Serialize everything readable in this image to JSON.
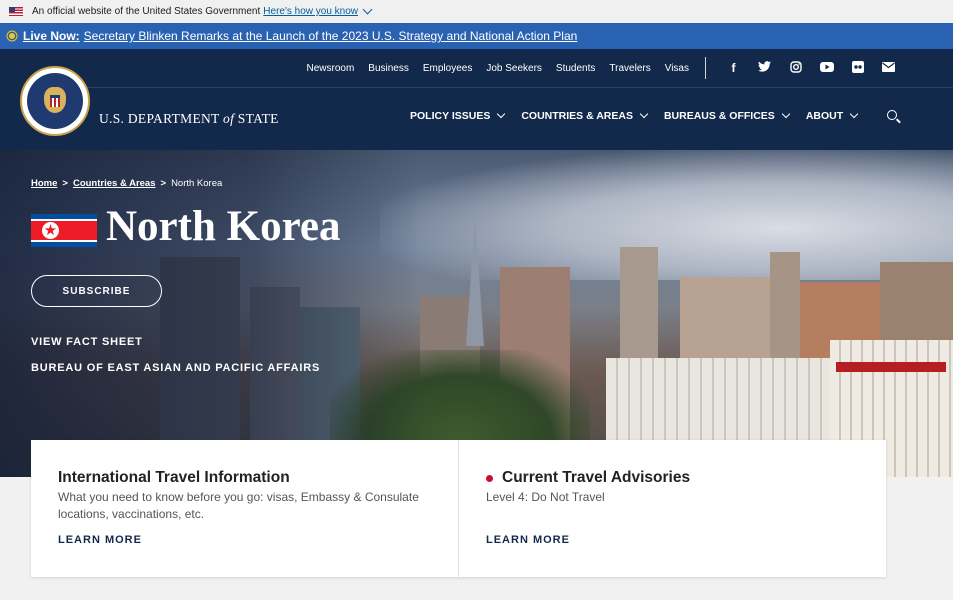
{
  "gov_banner": {
    "text": "An official website of the United States Government",
    "link": "Here's how you know"
  },
  "alert": {
    "label": "Live Now:",
    "message": "Secretary Blinken Remarks at the Launch of the 2023 U.S. Strategy and National Action Plan"
  },
  "utility_nav": [
    "Newsroom",
    "Business",
    "Employees",
    "Job Seekers",
    "Students",
    "Travelers",
    "Visas"
  ],
  "social_icons": [
    "facebook-icon",
    "twitter-icon",
    "instagram-icon",
    "youtube-icon",
    "flickr-icon",
    "email-icon"
  ],
  "brand": {
    "wordmark_pre": "U.S. DEPARTMENT ",
    "wordmark_of": "of",
    "wordmark_post": " STATE"
  },
  "main_nav": [
    "POLICY ISSUES",
    "COUNTRIES & AREAS",
    "BUREAUS & OFFICES",
    "ABOUT"
  ],
  "breadcrumb": {
    "home": "Home",
    "section": "Countries & Areas",
    "current": "North Korea",
    "sep": ">"
  },
  "hero": {
    "title": "North Korea",
    "subscribe_label": "SUBSCRIBE",
    "links": [
      "VIEW FACT SHEET",
      "BUREAU OF EAST ASIAN AND PACIFIC AFFAIRS"
    ]
  },
  "cards": [
    {
      "title": "International Travel Information",
      "text": "What you need to know before you go: visas, Embassy & Consulate locations, vaccinations, etc.",
      "cta": "LEARN MORE"
    },
    {
      "title": "Current Travel Advisories",
      "text": "Level 4: Do Not Travel",
      "cta": "LEARN MORE"
    }
  ],
  "colors": {
    "header_navy": "#13294b",
    "alert_blue": "#2a62b3",
    "advisory_red": "#c8102e"
  }
}
